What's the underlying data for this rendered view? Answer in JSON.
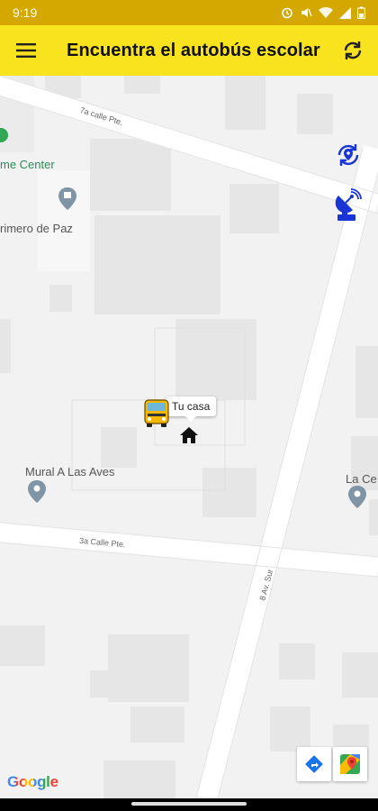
{
  "status_bar": {
    "time": "9:19",
    "icons": [
      "alarm-icon",
      "mute-icon",
      "wifi-icon",
      "signal-icon",
      "battery-icon"
    ]
  },
  "app_bar": {
    "title": "Encuentra el autobús escolar",
    "menu_icon": "menu-icon",
    "refresh_icon": "refresh-icon",
    "background": "#f9e21e"
  },
  "map": {
    "pois": {
      "home_center": "me Center",
      "primero_de_paz": "rimero de Paz",
      "mural": "Mural A Las Aves",
      "la_ce": "La Ce"
    },
    "roads": {
      "calle_7a": "7a calle Pte.",
      "calle_3a": "3a Calle Pte.",
      "av_sur": "8 Av. Sur"
    },
    "home_label": "Tu casa",
    "markers": [
      "school-bus-icon",
      "home-icon"
    ],
    "controls": [
      "recenter-location-icon",
      "satellite-dish-icon",
      "directions-icon",
      "google-maps-icon"
    ],
    "attribution": "Google",
    "accent_color": "#1a35d6"
  }
}
